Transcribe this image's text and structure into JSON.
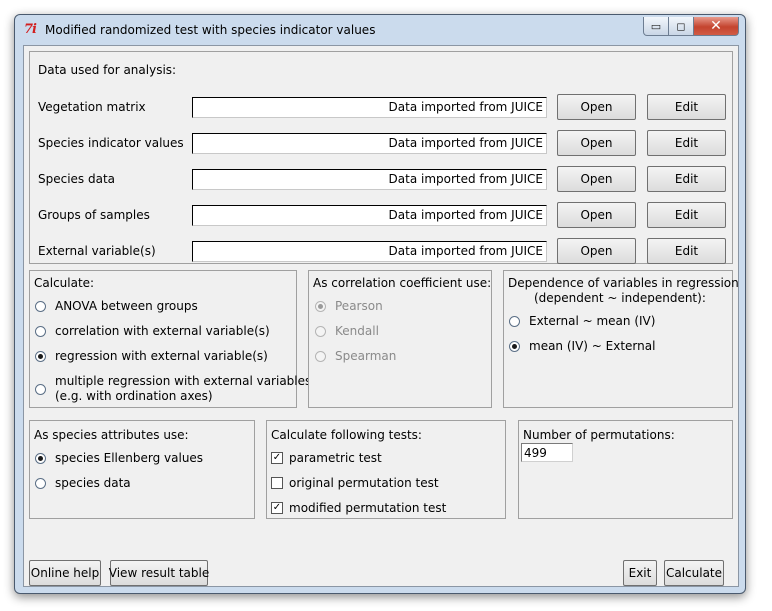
{
  "window": {
    "title": "Modified randomized test with species indicator values",
    "icon_text": "7i",
    "minimize": "▭",
    "maximize": "◻",
    "close": "✕"
  },
  "data_panel": {
    "title": "Data used for analysis:",
    "rows": [
      {
        "label": "Vegetation matrix",
        "value": "Data imported from JUICE",
        "open": "Open",
        "edit": "Edit"
      },
      {
        "label": "Species indicator values",
        "value": "Data imported from JUICE",
        "open": "Open",
        "edit": "Edit"
      },
      {
        "label": "Species data",
        "value": "Data imported from JUICE",
        "open": "Open",
        "edit": "Edit"
      },
      {
        "label": "Groups of samples",
        "value": "Data imported from JUICE",
        "open": "Open",
        "edit": "Edit"
      },
      {
        "label": "External variable(s)",
        "value": "Data imported from JUICE",
        "open": "Open",
        "edit": "Edit"
      }
    ]
  },
  "calculate_panel": {
    "title": "Calculate:",
    "options": [
      {
        "label": "ANOVA between groups",
        "checked": false
      },
      {
        "label": "correlation with external variable(s)",
        "checked": false
      },
      {
        "label": "regression with external variable(s)",
        "checked": true
      },
      {
        "label": "multiple regression with external variables",
        "label2": "(e.g. with ordination axes)",
        "checked": false
      }
    ]
  },
  "correlation_panel": {
    "title": "As correlation coefficient use:",
    "options": [
      {
        "label": "Pearson",
        "checked": true,
        "disabled": true
      },
      {
        "label": "Kendall",
        "checked": false,
        "disabled": true
      },
      {
        "label": "Spearman",
        "checked": false,
        "disabled": true
      }
    ]
  },
  "dependence_panel": {
    "title": "Dependence of variables in regression",
    "subtitle": "(dependent ~ independent):",
    "options": [
      {
        "label": "External ~ mean (IV)",
        "checked": false
      },
      {
        "label": "mean (IV) ~ External",
        "checked": true
      }
    ]
  },
  "attributes_panel": {
    "title": "As species attributes use:",
    "options": [
      {
        "label": "species Ellenberg values",
        "checked": true
      },
      {
        "label": "species data",
        "checked": false
      }
    ]
  },
  "tests_panel": {
    "title": "Calculate following tests:",
    "options": [
      {
        "label": "parametric test",
        "checked": true
      },
      {
        "label": "original permutation test",
        "checked": false
      },
      {
        "label": "modified permutation test",
        "checked": true
      }
    ]
  },
  "permutations_panel": {
    "title": "Number of permutations:",
    "value": "499"
  },
  "footer": {
    "online_help": "Online help",
    "view_result_table": "View result table",
    "exit": "Exit",
    "calculate": "Calculate"
  },
  "check_mark": "✓",
  "colors": {
    "frame": "#cbdbed",
    "client": "#f0f0f0",
    "close_button": "#c4442f",
    "app_icon": "#d21f1f"
  }
}
